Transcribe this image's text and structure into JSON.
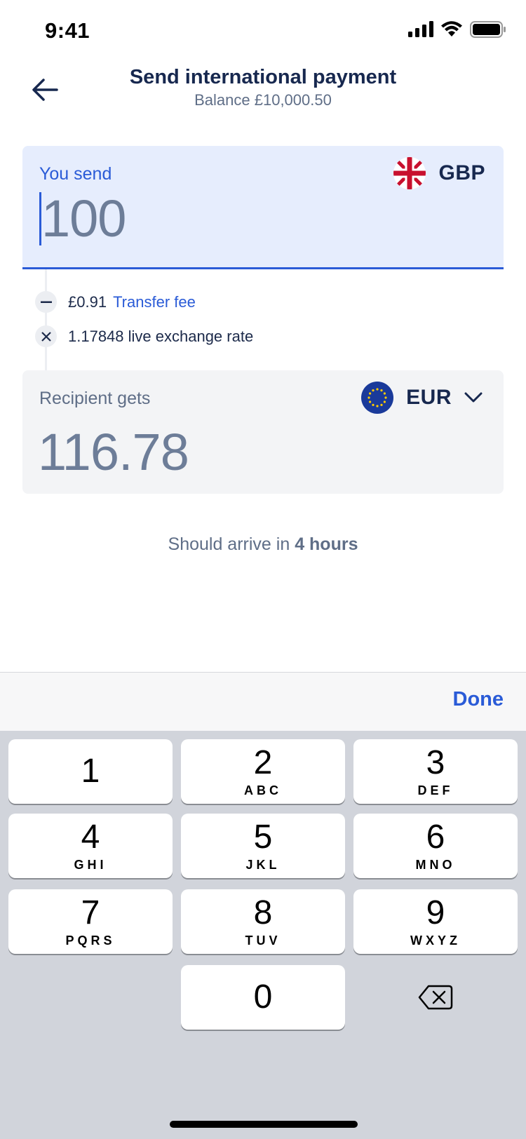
{
  "status_bar": {
    "time": "9:41"
  },
  "header": {
    "title": "Send international payment",
    "subtitle": "Balance £10,000.50"
  },
  "send": {
    "label": "You send",
    "currency": "GBP",
    "amount": "100"
  },
  "fees": {
    "fee_amount": "£0.91",
    "fee_link": "Transfer fee",
    "rate_text": "1.17848 live exchange rate"
  },
  "recipient": {
    "label": "Recipient gets",
    "currency": "EUR",
    "amount": "116.78"
  },
  "arrival": {
    "prefix": "Should arrive in",
    "time": "4 hours"
  },
  "keyboard": {
    "done_label": "Done",
    "keys": [
      {
        "digit": "1",
        "letters": ""
      },
      {
        "digit": "2",
        "letters": "ABC"
      },
      {
        "digit": "3",
        "letters": "DEF"
      },
      {
        "digit": "4",
        "letters": "GHI"
      },
      {
        "digit": "5",
        "letters": "JKL"
      },
      {
        "digit": "6",
        "letters": "MNO"
      },
      {
        "digit": "7",
        "letters": "PQRS"
      },
      {
        "digit": "8",
        "letters": "TUV"
      },
      {
        "digit": "9",
        "letters": "WXYZ"
      },
      {
        "digit": "0",
        "letters": ""
      }
    ]
  },
  "colors": {
    "accent": "#2a5bd7",
    "navy": "#17284f",
    "send_bg": "#e6edfd",
    "recv_bg": "#f3f4f6",
    "keypad_bg": "#d1d4db"
  },
  "icons": {
    "back": "arrow-left-icon",
    "gbp_flag": "uk-flag-icon",
    "eur_flag": "eu-flag-icon",
    "chevron": "chevron-down-icon",
    "minus": "minus-icon",
    "times": "multiply-icon",
    "delete": "backspace-icon"
  }
}
